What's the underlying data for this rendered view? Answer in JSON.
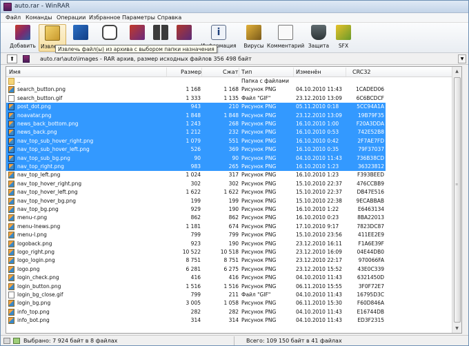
{
  "window": {
    "title": "auto.rar - WinRAR"
  },
  "menu": [
    "Файл",
    "Команды",
    "Операции",
    "Избранное",
    "Параметры",
    "Справка"
  ],
  "toolbar": {
    "buttons": [
      {
        "label": "Добавить",
        "icon": "books-add-icon"
      },
      {
        "label": "Извлечь",
        "icon": "folder-extract-icon"
      },
      {
        "label": "Тест",
        "icon": "test-icon"
      },
      {
        "label": "Просмотр",
        "icon": "view-glasses-icon"
      },
      {
        "label": "Удалить",
        "icon": "delete-icon"
      },
      {
        "label": "Найти",
        "icon": "binoculars-icon"
      },
      {
        "label": "Мастер",
        "icon": "wizard-icon"
      },
      {
        "label": "Информация",
        "icon": "info-icon"
      },
      {
        "label": "Вирусы",
        "icon": "virus-scan-icon"
      },
      {
        "label": "Комментарий",
        "icon": "comment-icon"
      },
      {
        "label": "Защита",
        "icon": "shield-icon"
      },
      {
        "label": "SFX",
        "icon": "sfx-icon"
      }
    ],
    "tooltip": "Извлечь файл(ы) из архива с выбором папки назначения"
  },
  "address": {
    "text": "auto.rar\\auto\\images - RAR архив, размер исходных файлов 356 498 байт"
  },
  "columns": {
    "name": "Имя",
    "size": "Размер",
    "packed": "Сжат",
    "type": "Тип",
    "modified": "Изменён",
    "crc": "CRC32"
  },
  "rows": [
    {
      "name": "..",
      "size": "",
      "packed": "",
      "type": "Папка с файлами",
      "modified": "",
      "crc": "",
      "kind": "folder",
      "selected": false
    },
    {
      "name": "search_button.png",
      "size": "1 168",
      "packed": "1 168",
      "type": "Рисунок PNG",
      "modified": "04.10.2010 11:43",
      "crc": "1CADED06",
      "kind": "png",
      "selected": false
    },
    {
      "name": "search_button.gif",
      "size": "1 333",
      "packed": "1 135",
      "type": "Файл \"GIF\"",
      "modified": "23.12.2010 13:09",
      "crc": "6C6BCDCF",
      "kind": "gif",
      "selected": false
    },
    {
      "name": "post_dot.png",
      "size": "943",
      "packed": "210",
      "type": "Рисунок PNG",
      "modified": "05.11.2010 0:18",
      "crc": "5CC94A1A",
      "kind": "png",
      "selected": true
    },
    {
      "name": "noavatar.png",
      "size": "1 848",
      "packed": "1 848",
      "type": "Рисунок PNG",
      "modified": "23.12.2010 13:09",
      "crc": "19B79F35",
      "kind": "png",
      "selected": true
    },
    {
      "name": "news_back_bottom.png",
      "size": "1 243",
      "packed": "268",
      "type": "Рисунок PNG",
      "modified": "16.10.2010 1:00",
      "crc": "F20A3DDA",
      "kind": "png",
      "selected": true
    },
    {
      "name": "news_back.png",
      "size": "1 212",
      "packed": "232",
      "type": "Рисунок PNG",
      "modified": "16.10.2010 0:53",
      "crc": "742E52B8",
      "kind": "png",
      "selected": true
    },
    {
      "name": "nav_top_sub_hover_right.png",
      "size": "1 079",
      "packed": "551",
      "type": "Рисунок PNG",
      "modified": "16.10.2010 0:42",
      "crc": "2F7AE7FD",
      "kind": "png",
      "selected": true
    },
    {
      "name": "nav_top_sub_hover_left.png",
      "size": "526",
      "packed": "369",
      "type": "Рисунок PNG",
      "modified": "16.10.2010 0:35",
      "crc": "79F37037",
      "kind": "png",
      "selected": true
    },
    {
      "name": "nav_top_sub_bg.png",
      "size": "90",
      "packed": "90",
      "type": "Рисунок PNG",
      "modified": "04.10.2010 11:43",
      "crc": "736B38CD",
      "kind": "png",
      "selected": true
    },
    {
      "name": "nav_top_right.png",
      "size": "983",
      "packed": "265",
      "type": "Рисунок PNG",
      "modified": "16.10.2010 1:23",
      "crc": "36323812",
      "kind": "png",
      "selected": true
    },
    {
      "name": "nav_top_left.png",
      "size": "1 024",
      "packed": "317",
      "type": "Рисунок PNG",
      "modified": "16.10.2010 1:23",
      "crc": "F393BEED",
      "kind": "png",
      "selected": false
    },
    {
      "name": "nav_top_hover_right.png",
      "size": "302",
      "packed": "302",
      "type": "Рисунок PNG",
      "modified": "15.10.2010 22:37",
      "crc": "476CCBB9",
      "kind": "png",
      "selected": false
    },
    {
      "name": "nav_top_hover_left.png",
      "size": "1 622",
      "packed": "1 622",
      "type": "Рисунок PNG",
      "modified": "15.10.2010 22:37",
      "crc": "DB47E516",
      "kind": "png",
      "selected": false
    },
    {
      "name": "nav_top_hover_bg.png",
      "size": "199",
      "packed": "199",
      "type": "Рисунок PNG",
      "modified": "15.10.2010 22:38",
      "crc": "9ECABBAB",
      "kind": "png",
      "selected": false
    },
    {
      "name": "nav_top_bg.png",
      "size": "929",
      "packed": "190",
      "type": "Рисунок PNG",
      "modified": "16.10.2010 1:22",
      "crc": "E6463134",
      "kind": "png",
      "selected": false
    },
    {
      "name": "menu-r.png",
      "size": "862",
      "packed": "862",
      "type": "Рисунок PNG",
      "modified": "16.10.2010 0:23",
      "crc": "8BA22013",
      "kind": "png",
      "selected": false
    },
    {
      "name": "menu-lnews.png",
      "size": "1 181",
      "packed": "674",
      "type": "Рисунок PNG",
      "modified": "17.10.2010 9:17",
      "crc": "7823DC87",
      "kind": "png",
      "selected": false
    },
    {
      "name": "menu-l.png",
      "size": "799",
      "packed": "799",
      "type": "Рисунок PNG",
      "modified": "15.10.2010 23:56",
      "crc": "411EE2E9",
      "kind": "png",
      "selected": false
    },
    {
      "name": "logoback.png",
      "size": "923",
      "packed": "190",
      "type": "Рисунок PNG",
      "modified": "23.12.2010 16:11",
      "crc": "F1A6E39F",
      "kind": "png",
      "selected": false
    },
    {
      "name": "logo_right.png",
      "size": "10 522",
      "packed": "10 518",
      "type": "Рисунок PNG",
      "modified": "23.12.2010 16:09",
      "crc": "04E44DB0",
      "kind": "png",
      "selected": false
    },
    {
      "name": "logo_login.png",
      "size": "8 751",
      "packed": "8 751",
      "type": "Рисунок PNG",
      "modified": "23.12.2010 22:17",
      "crc": "970066FA",
      "kind": "png",
      "selected": false
    },
    {
      "name": "logo.png",
      "size": "6 281",
      "packed": "6 275",
      "type": "Рисунок PNG",
      "modified": "23.12.2010 15:52",
      "crc": "43E0C339",
      "kind": "png",
      "selected": false
    },
    {
      "name": "login_check.png",
      "size": "416",
      "packed": "416",
      "type": "Рисунок PNG",
      "modified": "04.10.2010 11:43",
      "crc": "6321450D",
      "kind": "png",
      "selected": false
    },
    {
      "name": "login_button.png",
      "size": "1 516",
      "packed": "1 516",
      "type": "Рисунок PNG",
      "modified": "06.11.2010 15:55",
      "crc": "3F0F72E7",
      "kind": "png",
      "selected": false
    },
    {
      "name": "login_bg_close.gif",
      "size": "799",
      "packed": "211",
      "type": "Файл \"GIF\"",
      "modified": "04.10.2010 11:43",
      "crc": "16795D3C",
      "kind": "gif",
      "selected": false
    },
    {
      "name": "login_bg.png",
      "size": "3 005",
      "packed": "1 058",
      "type": "Рисунок PNG",
      "modified": "06.11.2010 15:30",
      "crc": "F60D846A",
      "kind": "png",
      "selected": false
    },
    {
      "name": "info_top.png",
      "size": "282",
      "packed": "282",
      "type": "Рисунок PNG",
      "modified": "04.10.2010 11:43",
      "crc": "E16744DB",
      "kind": "png",
      "selected": false
    },
    {
      "name": "info_bot.png",
      "size": "314",
      "packed": "314",
      "type": "Рисунок PNG",
      "modified": "04.10.2010 11:43",
      "crc": "ED3F2315",
      "kind": "png",
      "selected": false
    }
  ],
  "status": {
    "left": "Выбрано: 7 924 байт в 8 файлах",
    "right": "Всего: 109 150 байт в 41 файлах"
  }
}
